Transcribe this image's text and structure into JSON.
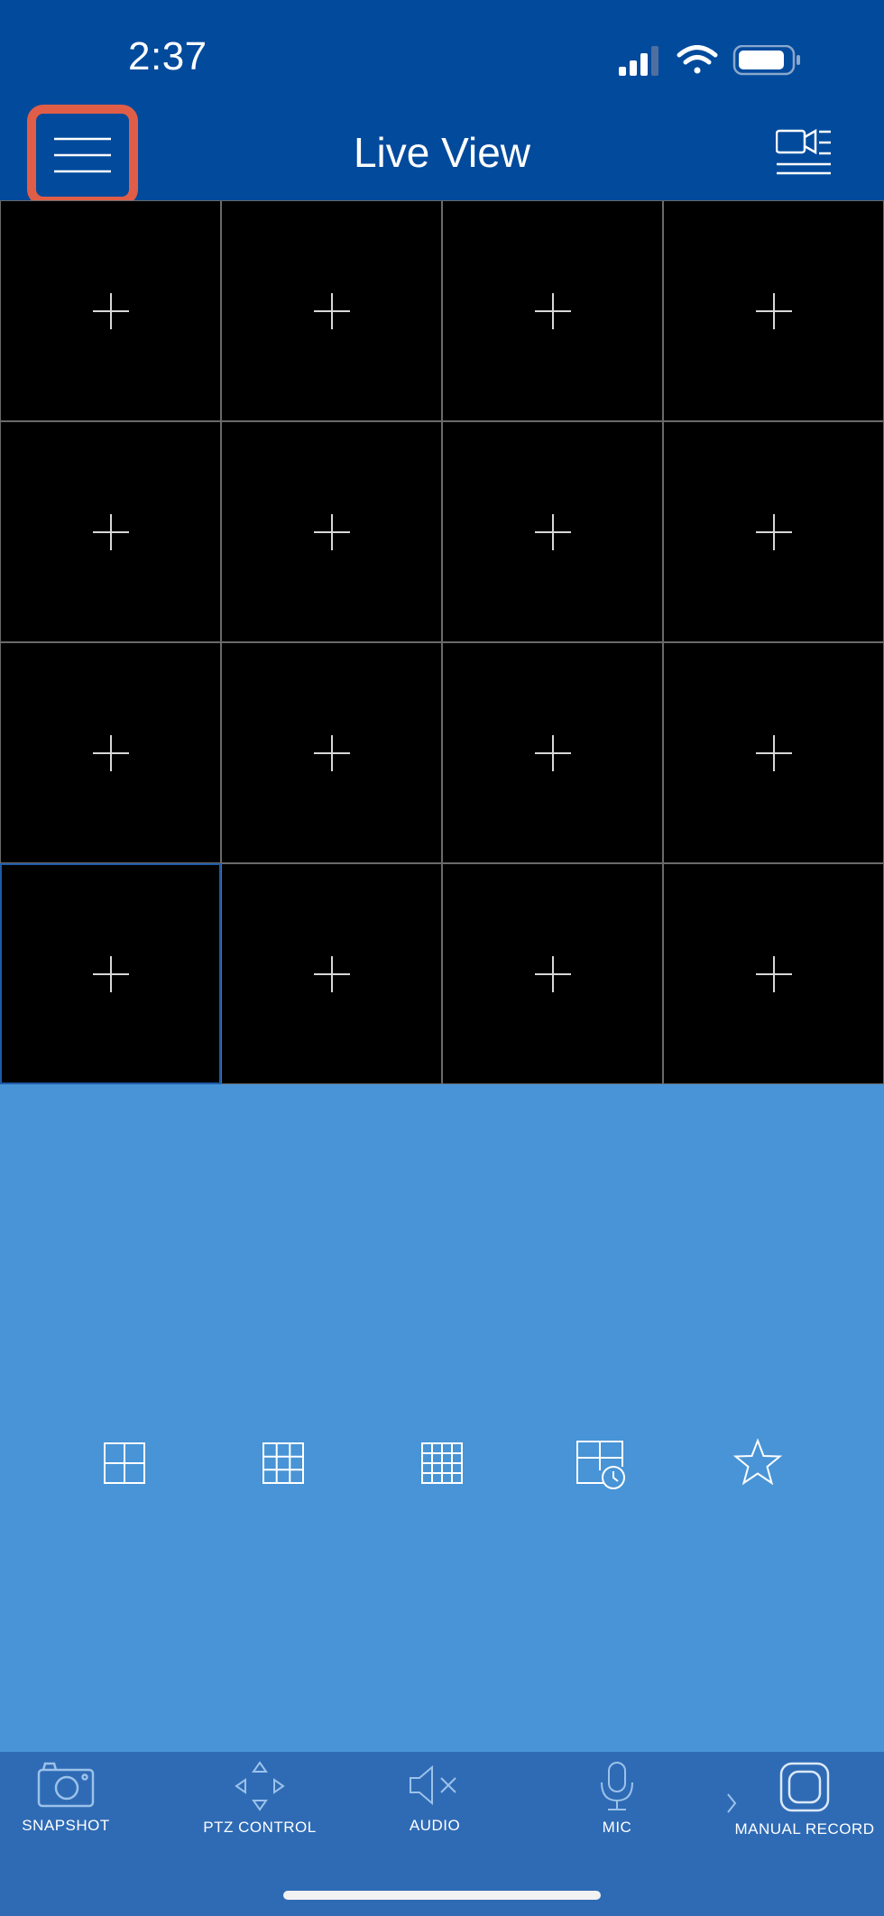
{
  "status_bar": {
    "time": "2:37",
    "icons": [
      "cellular-signal-icon",
      "wifi-icon",
      "battery-icon"
    ]
  },
  "nav": {
    "title": "Live View",
    "menu_icon": "hamburger-menu-icon",
    "right_icon": "camera-list-icon"
  },
  "grid": {
    "rows": 4,
    "columns": 4,
    "selected_cell": 13,
    "cell_icon": "plus-icon"
  },
  "layouts": [
    {
      "name": "2x2-layout-icon"
    },
    {
      "name": "3x3-layout-icon"
    },
    {
      "name": "4x4-layout-icon"
    },
    {
      "name": "scheduled-layout-icon"
    },
    {
      "name": "favorites-star-icon"
    }
  ],
  "toolbar": {
    "snapshot_label": "SNAPSHOT",
    "ptz_label": "PTZ CONTROL",
    "audio_label": "AUDIO",
    "mic_label": "MIC",
    "record_label": "MANUAL RECORD"
  },
  "colors": {
    "header_bg": "#024a9c",
    "body_bg": "#4894d6",
    "toolbar_bg": "#2f6bb5",
    "highlight": "#e05e48"
  }
}
